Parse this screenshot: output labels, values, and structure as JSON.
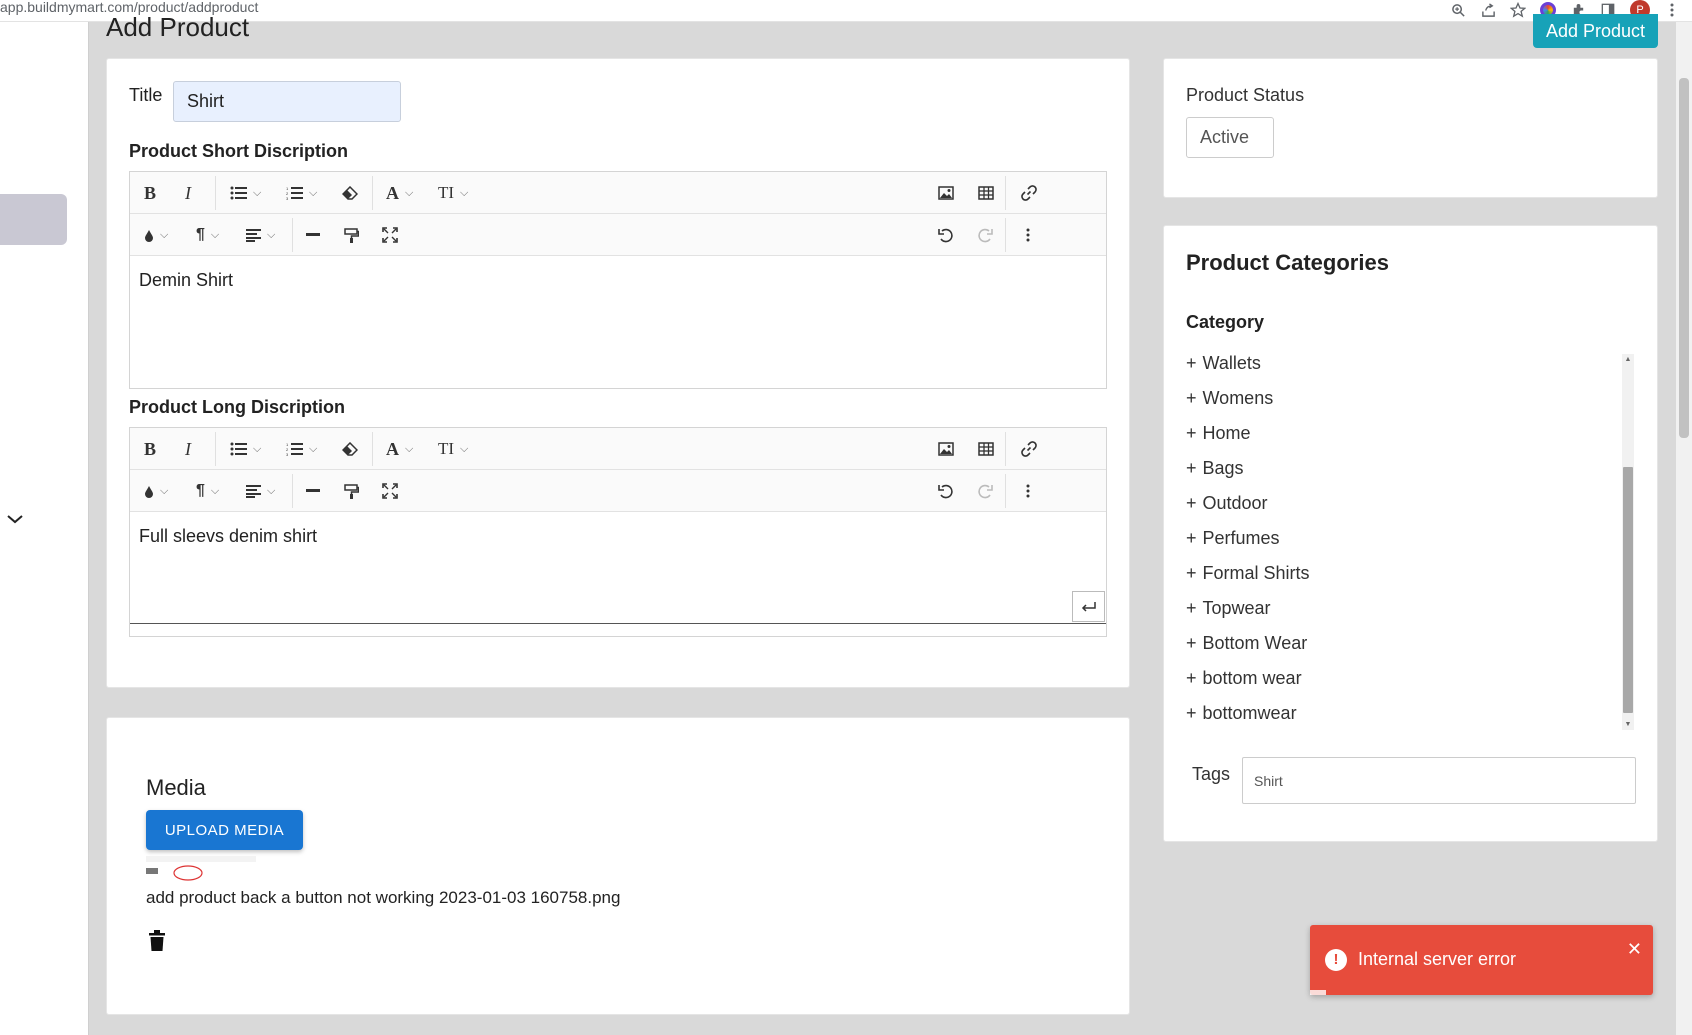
{
  "browser": {
    "url": "app.buildmymart.com/product/addproduct",
    "profile_initial": "P"
  },
  "header": {
    "page_title": "Add Product",
    "add_product_button": "Add Product"
  },
  "form": {
    "title_label": "Title",
    "title_value": "Shirt",
    "short_description_label": "Product Short Discription",
    "short_description_text": "Demin Shirt",
    "long_description_label": "Product Long Discription",
    "long_description_text": "Full sleevs denim shirt"
  },
  "media": {
    "title": "Media",
    "upload_button": "UPLOAD MEDIA",
    "file_name": "add product back a button not working 2023-01-03 160758.png"
  },
  "status": {
    "label": "Product Status",
    "value": "Active"
  },
  "categories": {
    "title": "Product Categories",
    "subtitle": "Category",
    "items": [
      {
        "label": "Wallets"
      },
      {
        "label": "Womens"
      },
      {
        "label": "Home"
      },
      {
        "label": "Bags"
      },
      {
        "label": "Outdoor"
      },
      {
        "label": "Perfumes"
      },
      {
        "label": "Formal Shirts"
      },
      {
        "label": "Topwear"
      },
      {
        "label": "Bottom Wear"
      },
      {
        "label": "bottom wear"
      },
      {
        "label": "bottomwear"
      }
    ],
    "plus_symbol": "+"
  },
  "tags": {
    "label": "Tags",
    "value": "Shirt"
  },
  "toast": {
    "message": "Internal server error",
    "icon": "!",
    "close": "✕"
  },
  "colors": {
    "accent_teal": "#17a2b8",
    "upload_blue": "#1976d2",
    "error_red": "#e74c3c"
  }
}
